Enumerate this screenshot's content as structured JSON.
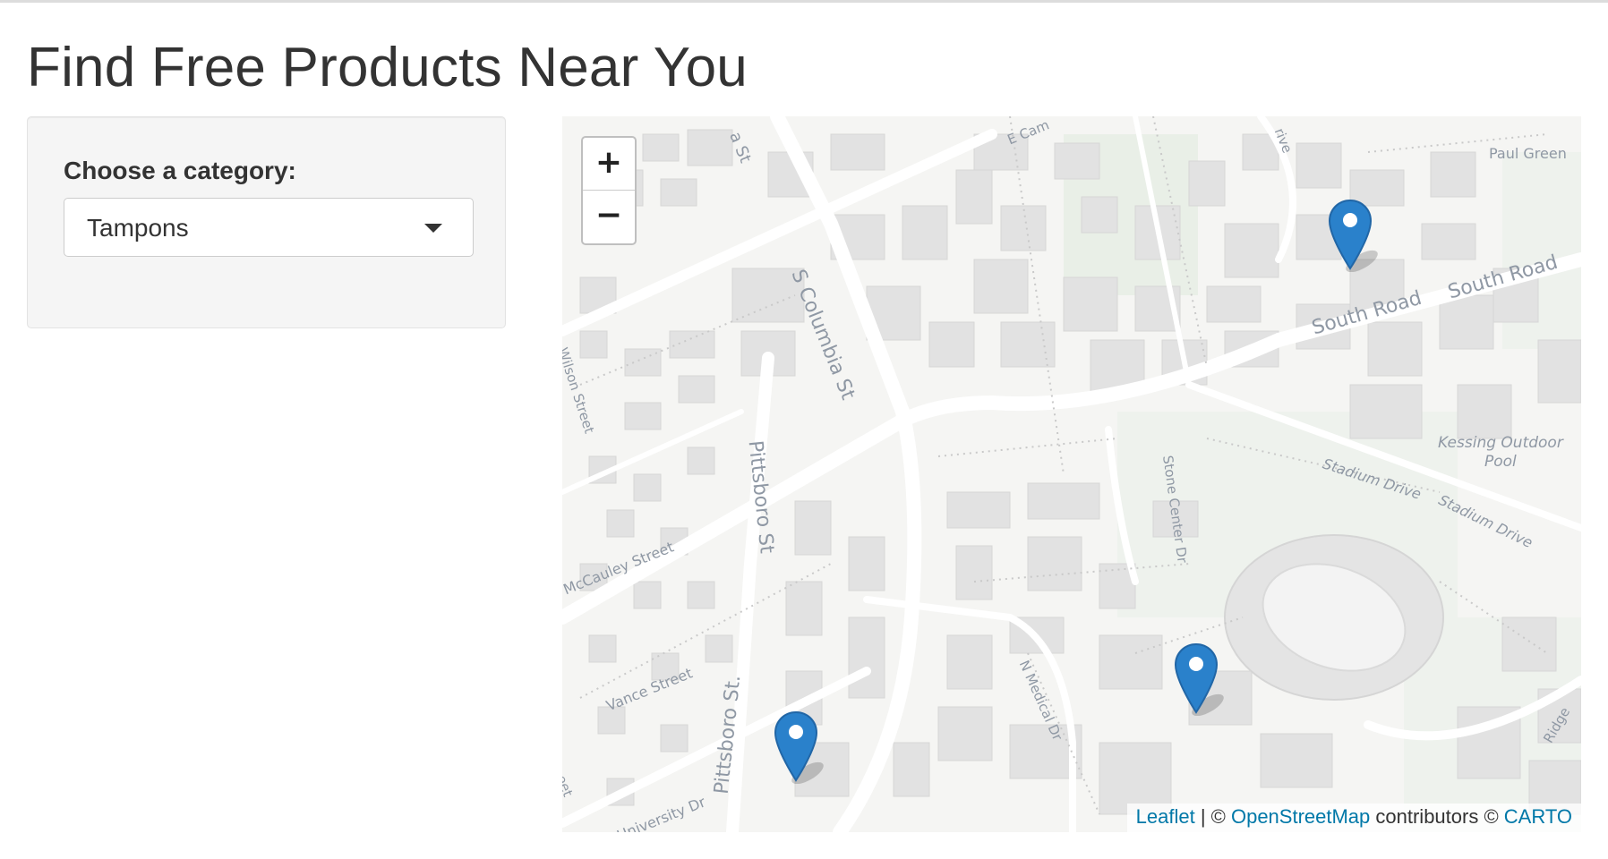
{
  "page": {
    "title": "Find Free Products Near You"
  },
  "sidebar": {
    "category_label": "Choose a category:",
    "category_value": "Tampons"
  },
  "map": {
    "zoom_in": "+",
    "zoom_out": "−",
    "attribution": {
      "leaflet": "Leaflet",
      "sep": " | © ",
      "osm": "OpenStreetMap",
      "contributors": " contributors © ",
      "carto": "CARTO"
    },
    "marker_color": "#2a81cb",
    "labels": {
      "s_columbia": "S Columbia St",
      "pittsboro_1": "Pittsboro St",
      "pittsboro_2": "Pittsboro St.",
      "south_road_1": "South Road",
      "south_road_2": "South Road",
      "stone_center": "Stone Center Dr",
      "stadium_1": "Stadium Drive",
      "stadium_2": "Stadium Drive",
      "kessing_1": "Kessing Outdoor",
      "kessing_2": "Pool",
      "paul_green": "Paul Green",
      "wilson": "Wilson Street",
      "mccauley": "McCauley Street",
      "vance": "Vance Street",
      "n_medical": "N Medical Dr",
      "university": "University Dr",
      "e_cam": "E Cam",
      "a_st": "a St",
      "drive": "rive",
      "ridge": "Ridge",
      "eet": "eet"
    }
  }
}
